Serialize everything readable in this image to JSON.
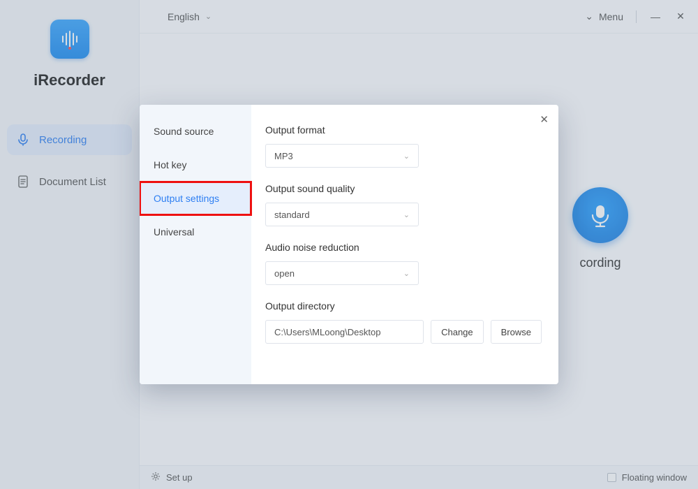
{
  "app": {
    "name": "iRecorder"
  },
  "topbar": {
    "language": "English",
    "menu_label": "Menu"
  },
  "sidebar": {
    "items": [
      {
        "label": "Recording",
        "active": true
      },
      {
        "label": "Document List",
        "active": false
      }
    ]
  },
  "main": {
    "record_visible_text": "cording"
  },
  "bottombar": {
    "setup_label": "Set up",
    "floating_label": "Floating window",
    "floating_checked": false
  },
  "modal": {
    "tabs": [
      {
        "label": "Sound source"
      },
      {
        "label": "Hot key"
      },
      {
        "label": "Output settings",
        "active": true,
        "highlighted": true
      },
      {
        "label": "Universal"
      }
    ],
    "fields": {
      "output_format": {
        "label": "Output format",
        "value": "MP3"
      },
      "output_quality": {
        "label": "Output sound quality",
        "value": "standard"
      },
      "noise_reduction": {
        "label": "Audio noise reduction",
        "value": "open"
      },
      "output_directory": {
        "label": "Output directory",
        "value": "C:\\Users\\MLoong\\Desktop",
        "change_label": "Change",
        "browse_label": "Browse"
      }
    }
  }
}
